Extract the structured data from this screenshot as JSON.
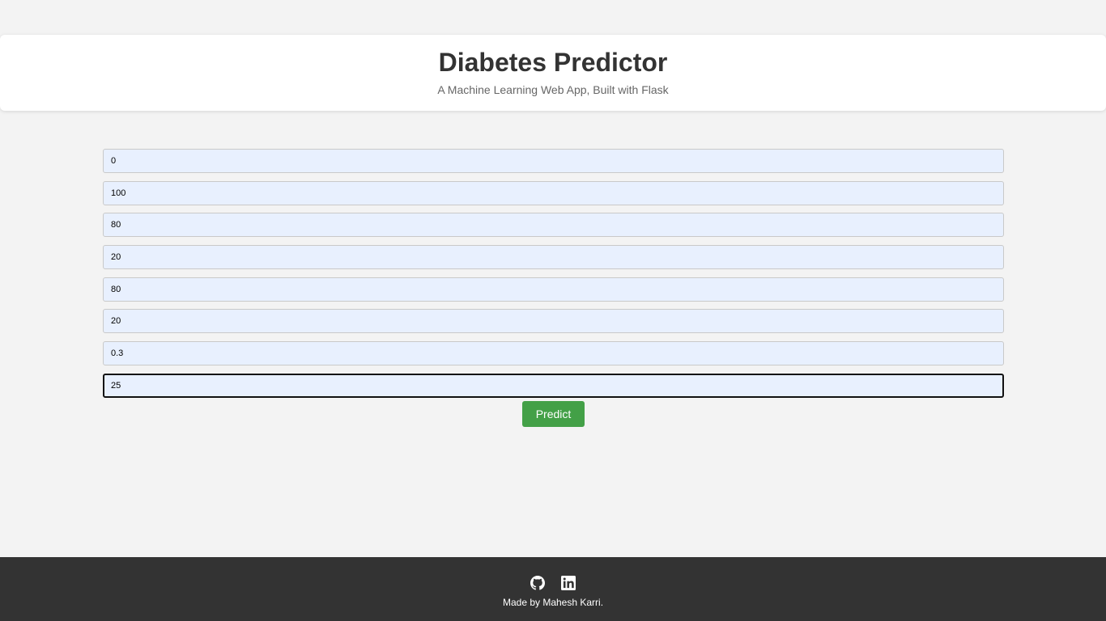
{
  "header": {
    "title": "Diabetes Predictor",
    "subtitle": "A Machine Learning Web App, Built with Flask"
  },
  "form": {
    "fields": [
      "0",
      "100",
      "80",
      "20",
      "80",
      "20",
      "0.3",
      "25"
    ],
    "predict_label": "Predict"
  },
  "footer": {
    "icons": [
      "github-icon",
      "linkedin-icon"
    ],
    "credit": "Made by Mahesh Karri."
  },
  "colors": {
    "background": "#f3f3f3",
    "input_background": "#e8f0fe",
    "button": "#43a047",
    "footer": "#333333"
  }
}
